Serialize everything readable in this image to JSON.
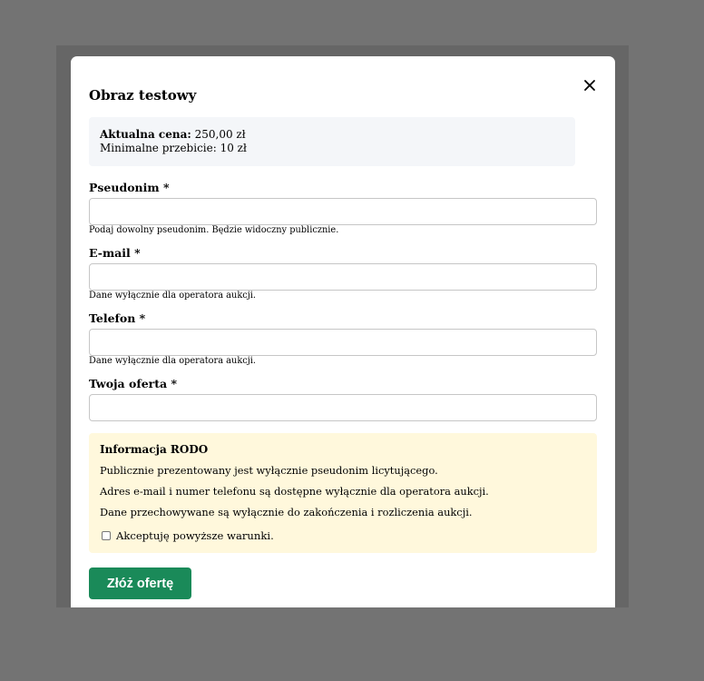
{
  "modal": {
    "title": "Obraz testowy",
    "close_icon": "close-icon"
  },
  "price": {
    "current_label": "Aktualna cena:",
    "current_value": "250,00 zł",
    "min_increment": "Minimalne przebicie: 10 zł"
  },
  "fields": {
    "nickname": {
      "label": "Pseudonim *",
      "value": "",
      "hint": "Podaj dowolny pseudonim. Będzie widoczny publicznie."
    },
    "email": {
      "label": "E-mail *",
      "value": "",
      "hint": "Dane wyłącznie dla operatora aukcji."
    },
    "phone": {
      "label": "Telefon *",
      "value": "",
      "hint": "Dane wyłącznie dla operatora aukcji."
    },
    "offer": {
      "label": "Twoja oferta *",
      "value": ""
    }
  },
  "rodo": {
    "title": "Informacja RODO",
    "lines": [
      "Publicznie prezentowany jest wyłącznie pseudonim licytującego.",
      "Adres e-mail i numer telefonu są dostępne wyłącznie dla operatora aukcji.",
      "Dane przechowywane są wyłącznie do zakończenia i rozliczenia aukcji."
    ],
    "accept_label": "Akceptuję powyższe warunki.",
    "accepted": false
  },
  "submit": {
    "label": "Złóż ofertę"
  },
  "colors": {
    "overlay": "#737373",
    "accent_button": "#1a8a59",
    "rodo_background": "#fff8dc",
    "price_background": "#f4f6f9"
  }
}
